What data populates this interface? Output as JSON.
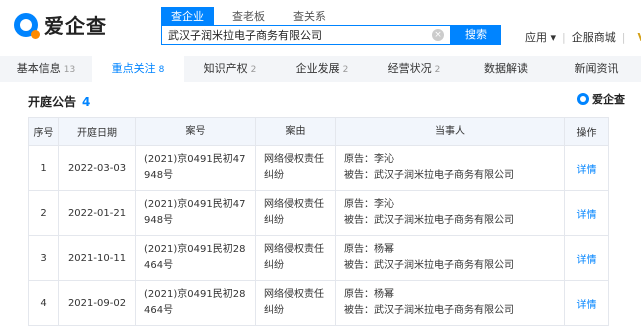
{
  "logo": {
    "text": "爱企查"
  },
  "search": {
    "tabs": [
      "查企业",
      "查老板",
      "查关系"
    ],
    "active_tab": 0,
    "value": "武汉子润米拉电子商务有限公司",
    "button_label": "搜索",
    "clear_icon": "×"
  },
  "header_right": {
    "apps_label": "应用 ▾",
    "mall_label": "企服商城",
    "vip_label": "V"
  },
  "nav": {
    "items": [
      {
        "label": "基本信息",
        "count": "13"
      },
      {
        "label": "重点关注",
        "count": "8"
      },
      {
        "label": "知识产权",
        "count": "2"
      },
      {
        "label": "企业发展",
        "count": "2"
      },
      {
        "label": "经营状况",
        "count": "2"
      },
      {
        "label": "数据解读",
        "count": ""
      },
      {
        "label": "新闻资讯",
        "count": ""
      }
    ],
    "active_index": 1
  },
  "section": {
    "title": "开庭公告",
    "count": "4",
    "badge": "爱企查"
  },
  "table": {
    "headers": [
      "序号",
      "开庭日期",
      "案号",
      "案由",
      "当事人",
      "操作"
    ],
    "rows": [
      {
        "idx": "1",
        "date": "2022-03-03",
        "case_no_1": "(2021)京0491民初47",
        "case_no_2": "948号",
        "cause_1": "网络侵权责任",
        "cause_2": "纠纷",
        "plaintiff": "原告：李沁",
        "defendant": "被告：武汉子润米拉电子商务有限公司",
        "op": "详情"
      },
      {
        "idx": "2",
        "date": "2022-01-21",
        "case_no_1": "(2021)京0491民初47",
        "case_no_2": "948号",
        "cause_1": "网络侵权责任",
        "cause_2": "纠纷",
        "plaintiff": "原告：李沁",
        "defendant": "被告：武汉子润米拉电子商务有限公司",
        "op": "详情"
      },
      {
        "idx": "3",
        "date": "2021-10-11",
        "case_no_1": "(2021)京0491民初28",
        "case_no_2": "464号",
        "cause_1": "网络侵权责任",
        "cause_2": "纠纷",
        "plaintiff": "原告：杨幂",
        "defendant": "被告：武汉子润米拉电子商务有限公司",
        "op": "详情"
      },
      {
        "idx": "4",
        "date": "2021-09-02",
        "case_no_1": "(2021)京0491民初28",
        "case_no_2": "464号",
        "cause_1": "网络侵权责任",
        "cause_2": "纠纷",
        "plaintiff": "原告：杨幂",
        "defendant": "被告：武汉子润米拉电子商务有限公司",
        "op": "详情"
      }
    ]
  },
  "colors": {
    "accent": "#0084ff",
    "logo_dot": "#ff8a00",
    "header_bg": "#f2f6fc"
  }
}
